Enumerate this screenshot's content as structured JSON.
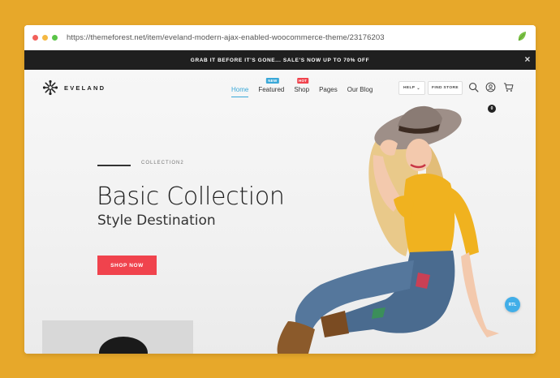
{
  "browser": {
    "url": "https://themeforest.net/item/eveland-modern-ajax-enabled-woocommerce-theme/23176203",
    "dot_colors": [
      "#f2605a",
      "#f5b842",
      "#5ac448"
    ],
    "leaf_icon": "envato-leaf-icon"
  },
  "promo_bar": {
    "text": "GRAB IT BEFORE IT'S GONE... SALE'S NOW UP TO 70% OFF",
    "close_icon": "close-icon"
  },
  "header": {
    "brand": "EVELAND",
    "nav": [
      {
        "label": "Home",
        "active": true,
        "badge": null
      },
      {
        "label": "Featured",
        "active": false,
        "badge": "NEW",
        "badge_color": "#3aa8d8"
      },
      {
        "label": "Shop",
        "active": false,
        "badge": "HOT",
        "badge_color": "#f0434d"
      },
      {
        "label": "Pages",
        "active": false,
        "badge": null
      },
      {
        "label": "Our Blog",
        "active": false,
        "badge": null
      }
    ],
    "help_label": "HELP",
    "find_store_label": "FIND STORE",
    "icons": [
      "search-icon",
      "user-icon",
      "cart-icon"
    ],
    "cart_count": "0"
  },
  "hero": {
    "eyebrow": "COLLECTION2",
    "title": "Basic Collection",
    "subtitle": "Style Destination",
    "cta_label": "SHOP NOW",
    "cta_color": "#f0434d"
  },
  "rtl_button": "RTL"
}
